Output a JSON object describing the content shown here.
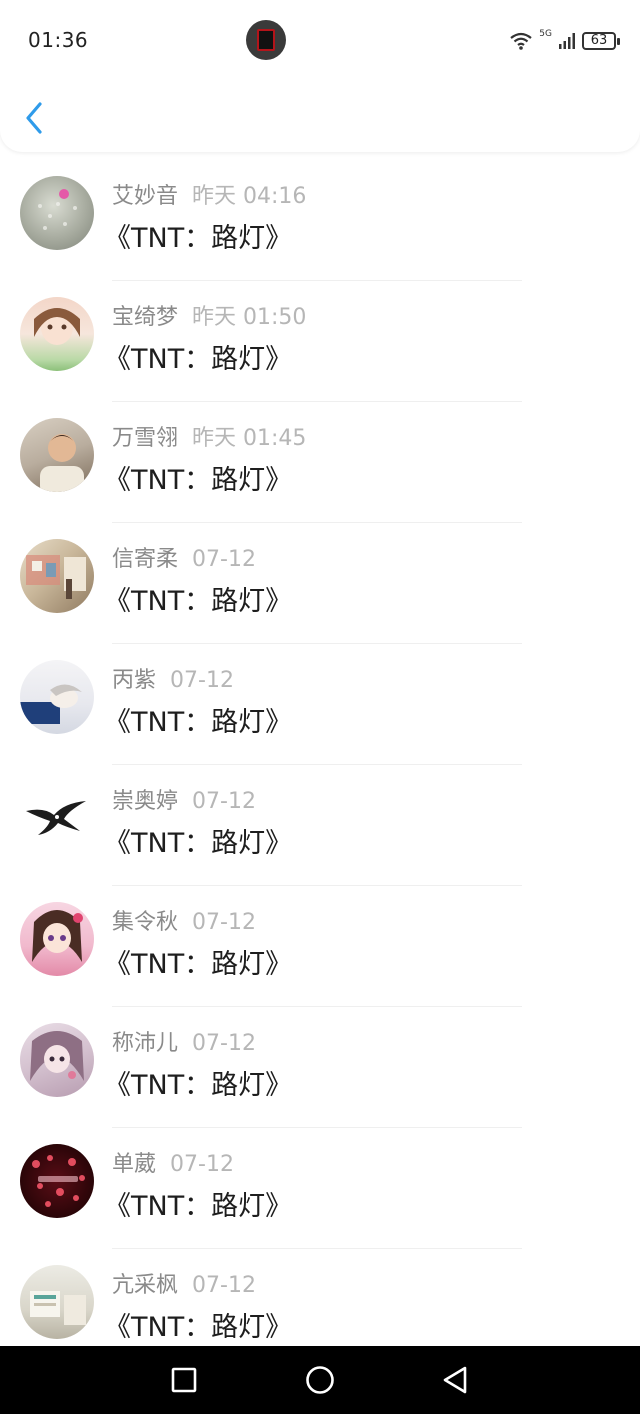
{
  "status_bar": {
    "time": "01:36",
    "battery": "63",
    "network": "5G"
  },
  "messages": [
    {
      "name": "艾妙音",
      "time": "昨天 04:16",
      "title": "《TNT：路灯》"
    },
    {
      "name": "宝绮梦",
      "time": "昨天 01:50",
      "title": "《TNT：路灯》"
    },
    {
      "name": "万雪翎",
      "time": "昨天 01:45",
      "title": "《TNT：路灯》"
    },
    {
      "name": "信寄柔",
      "time": "07-12",
      "title": "《TNT：路灯》"
    },
    {
      "name": "丙紫",
      "time": "07-12",
      "title": "《TNT：路灯》"
    },
    {
      "name": "崇奥婷",
      "time": "07-12",
      "title": "《TNT：路灯》"
    },
    {
      "name": "集令秋",
      "time": "07-12",
      "title": "《TNT：路灯》"
    },
    {
      "name": "称沛儿",
      "time": "07-12",
      "title": "《TNT：路灯》"
    },
    {
      "name": "单葳",
      "time": "07-12",
      "title": "《TNT：路灯》"
    },
    {
      "name": "亢采枫",
      "time": "07-12",
      "title": "《TNT：路灯》"
    }
  ],
  "colors": {
    "accent": "#2f9bea",
    "name_text": "#8a8a8a",
    "time_text": "#b6b6b6",
    "title_text": "#1e1e1e"
  }
}
